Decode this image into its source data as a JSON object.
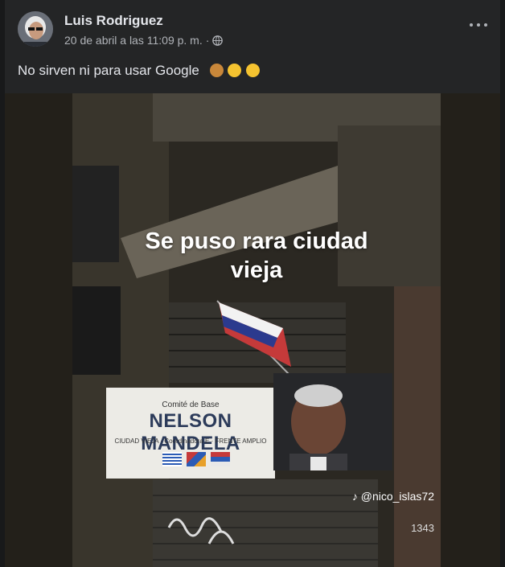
{
  "post": {
    "author": "Luis Rodriguez",
    "timestamp": "20 de abril a las 11:09 p. m.",
    "separator": "·",
    "privacy_icon": "globe-icon",
    "caption": "No sirven ni para usar Google",
    "caption_emojis": [
      "see-no-evil-monkey",
      "rolling-on-floor-laughing",
      "rolling-on-floor-laughing"
    ]
  },
  "video": {
    "overlay_text_line1": "Se puso rara ciudad",
    "overlay_text_line2": "vieja",
    "watermark": "@nico_islas72",
    "building_number": "1343",
    "sign": {
      "top": "Comité de Base",
      "main": "NELSON MANDELA",
      "sub": "CIUDAD VIEJA · Coordinadora E · FRENTE AMPLIO"
    }
  },
  "colors": {
    "background": "#18191a",
    "card": "#242526",
    "text_primary": "#e4e6eb",
    "text_secondary": "#b0b3b8"
  }
}
